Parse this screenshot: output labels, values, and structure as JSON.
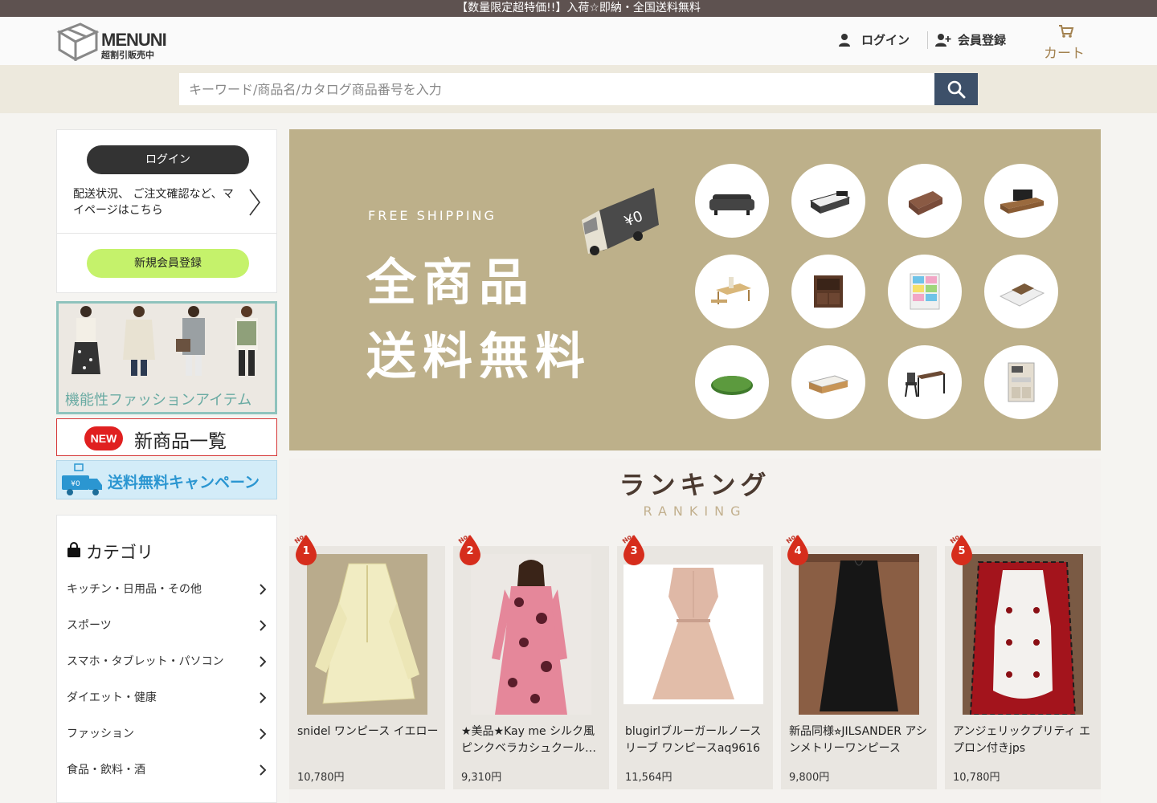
{
  "topbar": {
    "text": "【数量限定超特価!!】入荷☆即納・全国送料無料"
  },
  "header": {
    "logo_title": "MENUNI",
    "logo_sub": "超割引販売中",
    "login_label": "ログイン",
    "register_label": "会員登録",
    "cart_label": "カート"
  },
  "search": {
    "placeholder": "キーワード/商品名/カタログ商品番号を入力"
  },
  "sidebar": {
    "login_button": "ログイン",
    "mypage_text": "配送状況、 ご注文確認など、マイページはこちら",
    "register_button": "新規会員登録",
    "fashion_banner": "機能性ファッションアイテム",
    "new_badge": "NEW",
    "new_banner": "新商品一覧",
    "ship_banner": "送料無料キャンペーン",
    "category_title": "カテゴリ",
    "categories": [
      "キッチン・日用品・その他",
      "スポーツ",
      "スマホ・タブレット・パソコン",
      "ダイエット・健康",
      "ファッション",
      "食品・飲料・酒"
    ]
  },
  "hero": {
    "free_shipping": "FREE SHIPPING",
    "line1": "全商品",
    "line2": "送料無料",
    "truck_label": "¥0"
  },
  "ranking": {
    "title": "ランキング",
    "subtitle": "RANKING",
    "no_label": "No.",
    "items": [
      {
        "rank": "1",
        "name": "snidel ワンピース イエロー",
        "price": "10,780円"
      },
      {
        "rank": "2",
        "name": "★美品★Kay me シルク風 ピンクベラカシュクール…",
        "price": "9,310円"
      },
      {
        "rank": "3",
        "name": "blugirlブルーガールノースリーブ ワンピースaq9616",
        "price": "11,564円"
      },
      {
        "rank": "4",
        "name": "新品同様⭐︎JILSANDER アシンメトリーワンピース",
        "price": "9,800円"
      },
      {
        "rank": "5",
        "name": "アンジェリックプリティ エプロン付きjps",
        "price": "10,780円"
      }
    ]
  },
  "colors": {
    "topbar": "#5e5250",
    "accent_gold": "#a2814f",
    "search_button": "#3d5069",
    "register_green": "#c5f26b",
    "hero_bg": "#bdb08a",
    "rank_red": "#d62d1c"
  }
}
